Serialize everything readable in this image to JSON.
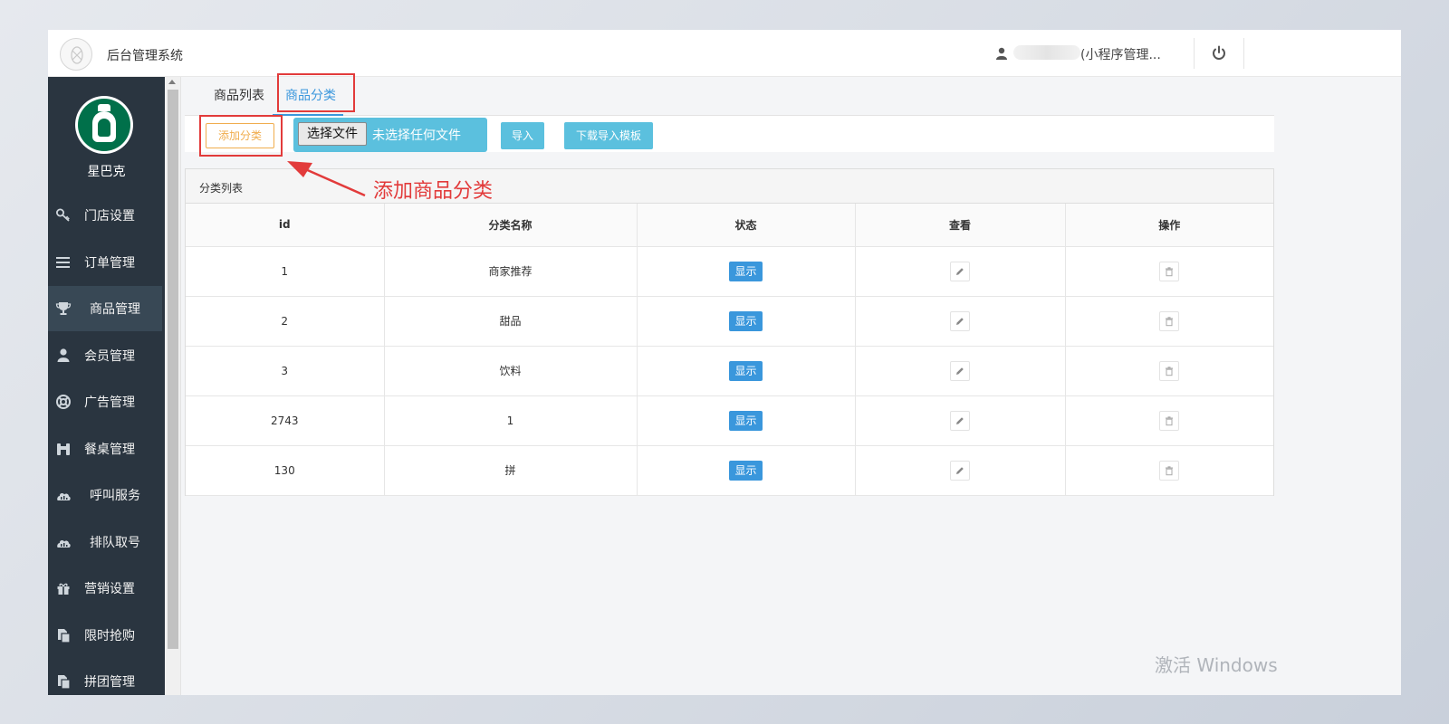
{
  "header": {
    "app_title": "后台管理系统",
    "user_name": "(小程序管理..."
  },
  "sidebar": {
    "brand_name": "星巴克",
    "items": [
      {
        "label": "门店设置",
        "icon": "key-icon"
      },
      {
        "label": "订单管理",
        "icon": "list-icon"
      },
      {
        "label": "商品管理",
        "icon": "trophy-icon",
        "active": true
      },
      {
        "label": "会员管理",
        "icon": "user-icon"
      },
      {
        "label": "广告管理",
        "icon": "lifebuoy-icon"
      },
      {
        "label": "餐桌管理",
        "icon": "binoculars-icon"
      },
      {
        "label": "呼叫服务",
        "icon": "cloud-icon"
      },
      {
        "label": "排队取号",
        "icon": "cloud-icon"
      },
      {
        "label": "营销设置",
        "icon": "gift-icon"
      },
      {
        "label": "限时抢购",
        "icon": "copy-icon"
      },
      {
        "label": "拼团管理",
        "icon": "copy-icon"
      }
    ]
  },
  "tabs": {
    "product_list": "商品列表",
    "product_category": "商品分类"
  },
  "toolbar": {
    "add_category": "添加分类",
    "choose_file": "选择文件",
    "no_file": "未选择任何文件",
    "import": "导入",
    "download_template": "下载导入模板"
  },
  "panel": {
    "title": "分类列表",
    "columns": [
      "id",
      "分类名称",
      "状态",
      "查看",
      "操作"
    ],
    "rows": [
      {
        "id": "1",
        "name": "商家推荐",
        "status": "显示"
      },
      {
        "id": "2",
        "name": "甜品",
        "status": "显示"
      },
      {
        "id": "3",
        "name": "饮料",
        "status": "显示"
      },
      {
        "id": "2743",
        "name": "1",
        "status": "显示"
      },
      {
        "id": "130",
        "name": "拼",
        "status": "显示"
      }
    ]
  },
  "annotation": {
    "text": "添加商品分类"
  },
  "watermark": "激活 Windows",
  "colors": {
    "sidebar_bg": "#2a3540",
    "accent_blue": "#3a97dc",
    "info_blue": "#5bc0de",
    "warning_orange": "#f0ad4e",
    "annotation_red": "#e23b3b"
  }
}
